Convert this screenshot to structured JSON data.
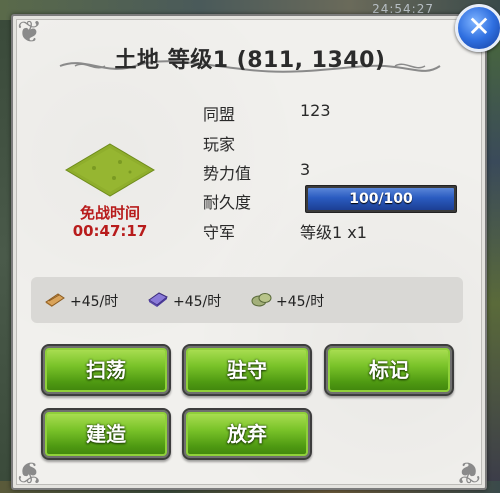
{
  "world": {
    "clock": "24:54:27"
  },
  "dialog": {
    "title": "土地 等级1 (811, 1340)",
    "truce_label": "免战时间",
    "truce_time": "00:47:17"
  },
  "info": {
    "alliance_label": "同盟",
    "alliance_value": "123",
    "player_label": "玩家",
    "player_value": "",
    "power_label": "势力值",
    "power_value": "3",
    "durability_label": "耐久度",
    "durability_value": "100/100",
    "durability_fraction": 1.0,
    "garrison_label": "守军",
    "garrison_value": "等级1 x1"
  },
  "resources": [
    {
      "icon": "wood-icon",
      "text": "+45/时"
    },
    {
      "icon": "iron-icon",
      "text": "+45/时"
    },
    {
      "icon": "stone-icon",
      "text": "+45/时"
    }
  ],
  "buttons": {
    "sweep": "扫荡",
    "garrison": "驻守",
    "mark": "标记",
    "build": "建造",
    "abandon": "放弃"
  },
  "colors": {
    "button_green": "#6fb822",
    "truce_red": "#b81c1c",
    "durability_blue": "#2a5bc0",
    "close_blue": "#2f6fe0"
  }
}
